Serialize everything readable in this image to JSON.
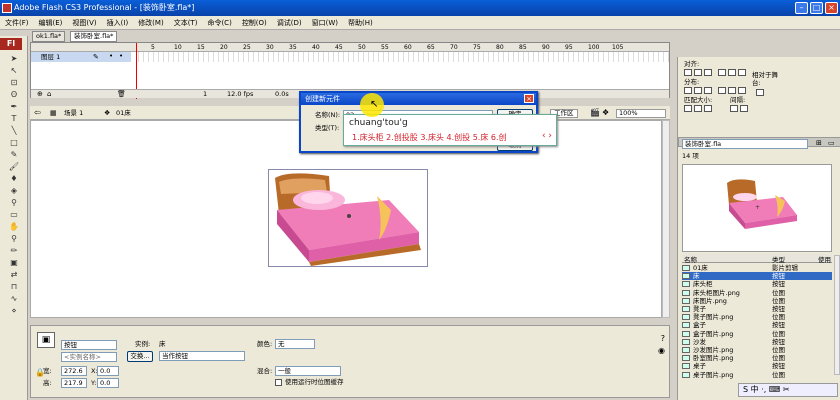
{
  "app": {
    "title": "Adobe Flash CS3 Professional - [装饰卧室.fla*]",
    "brand_badge": "Fl"
  },
  "menu": [
    "文件(F)",
    "编辑(E)",
    "视图(V)",
    "插入(I)",
    "修改(M)",
    "文本(T)",
    "命令(C)",
    "控制(O)",
    "调试(D)",
    "窗口(W)",
    "帮助(H)"
  ],
  "doc_tabs": [
    "ok1.fla*",
    "装饰卧室.fla*"
  ],
  "timeline": {
    "layer_name": "图层 1",
    "frame_ticks": [
      "5",
      "10",
      "15",
      "20",
      "25",
      "30",
      "35",
      "40",
      "45",
      "50",
      "55",
      "60",
      "65",
      "70",
      "75",
      "80",
      "85",
      "90",
      "95",
      "100",
      "105"
    ],
    "frame_number": "1",
    "fps": "12.0 fps",
    "elapsed": "0.0s"
  },
  "edit_bar": {
    "scene": "场景 1",
    "symbol": "01床",
    "workspace": "工作区",
    "zoom": "100%"
  },
  "dialog": {
    "title": "创建新元件",
    "name_label": "名称(N):",
    "name_value": "02",
    "type_label": "类型(T):",
    "ok_label": "确定",
    "cancel_label": "取消"
  },
  "ime": {
    "input": "chuang'tou'g",
    "candidates": "1.床头柜 2.创投股 3.床头 4.创投 5.床 6.创"
  },
  "properties": {
    "symbol_type": "按钮",
    "instance_name_placeholder": "<实例名称>",
    "instance_of_label": "实例:",
    "instance_of_value": "床",
    "swap_label": "交换...",
    "track_value": "当作按钮",
    "color_label": "颜色:",
    "color_value": "无",
    "width_label": "宽:",
    "width_value": "272.6",
    "height_label": "高:",
    "height_value": "217.9",
    "x_label": "X:",
    "x_value": "0.0",
    "y_label": "Y:",
    "y_value": "0.0",
    "blend_label": "混合:",
    "blend_value": "一般",
    "cache_label": "使用运行时位图缓存"
  },
  "align_panel": {
    "title": "对齐:",
    "distribute": "分布:",
    "match_size": "匹配大小:",
    "spacing": "间隔:",
    "to_stage": "相对于舞台:"
  },
  "library": {
    "document": "装饰卧室.fla",
    "count": "14 项",
    "col_name": "名称",
    "col_type": "类型",
    "col_use": "使用",
    "items": [
      {
        "name": "01床",
        "type": "影片剪辑",
        "selected": false
      },
      {
        "name": "床",
        "type": "按钮",
        "selected": true
      },
      {
        "name": "床头柜",
        "type": "按钮",
        "selected": false
      },
      {
        "name": "床头柜图片.png",
        "type": "位图",
        "selected": false
      },
      {
        "name": "床图片.png",
        "type": "位图",
        "selected": false
      },
      {
        "name": "凳子",
        "type": "按钮",
        "selected": false
      },
      {
        "name": "凳子图片.png",
        "type": "位图",
        "selected": false
      },
      {
        "name": "盒子",
        "type": "按钮",
        "selected": false
      },
      {
        "name": "盒子图片.png",
        "type": "位图",
        "selected": false
      },
      {
        "name": "沙发",
        "type": "按钮",
        "selected": false
      },
      {
        "name": "沙发图片.png",
        "type": "位图",
        "selected": false
      },
      {
        "name": "卧室图片.png",
        "type": "位图",
        "selected": false
      },
      {
        "name": "桌子",
        "type": "按钮",
        "selected": false
      },
      {
        "name": "桌子图片.png",
        "type": "位图",
        "selected": false
      }
    ]
  },
  "taskbar": {
    "ime_indicator": "S 中 ·, ⌨ ✂"
  },
  "colors": {
    "title_blue": "#0a46c8",
    "selection": "#316ac5",
    "flash_red": "#a8281f",
    "bed_pink": "#f07cb8",
    "bed_wood": "#b86a28",
    "ime_red": "#d2202a"
  }
}
